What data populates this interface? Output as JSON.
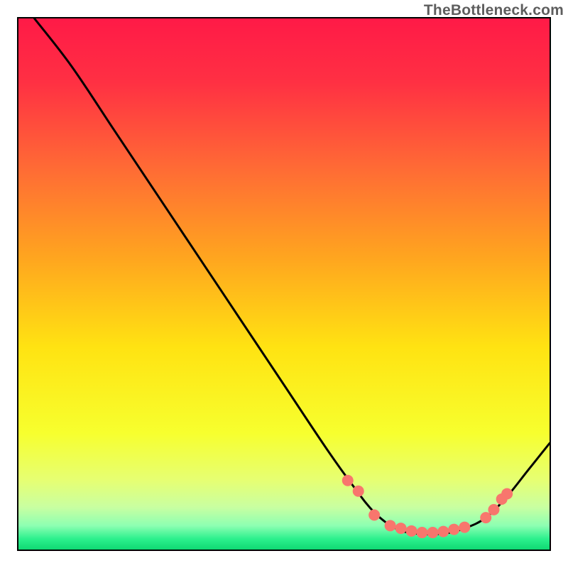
{
  "watermark": "TheBottleneck.com",
  "chart_data": {
    "type": "line",
    "title": "",
    "xlabel": "",
    "ylabel": "",
    "xlim": [
      0,
      100
    ],
    "ylim": [
      0,
      100
    ],
    "curve": [
      {
        "x": 3,
        "y": 100
      },
      {
        "x": 10,
        "y": 91
      },
      {
        "x": 18,
        "y": 79
      },
      {
        "x": 26,
        "y": 67
      },
      {
        "x": 34,
        "y": 55
      },
      {
        "x": 42,
        "y": 43
      },
      {
        "x": 50,
        "y": 31
      },
      {
        "x": 58,
        "y": 19
      },
      {
        "x": 63,
        "y": 12
      },
      {
        "x": 67,
        "y": 7
      },
      {
        "x": 71,
        "y": 4
      },
      {
        "x": 75,
        "y": 3
      },
      {
        "x": 80,
        "y": 3
      },
      {
        "x": 84,
        "y": 4
      },
      {
        "x": 88,
        "y": 6
      },
      {
        "x": 92,
        "y": 10
      },
      {
        "x": 96,
        "y": 15
      },
      {
        "x": 100,
        "y": 20
      }
    ],
    "markers": [
      {
        "x": 62,
        "y": 13
      },
      {
        "x": 64,
        "y": 11
      },
      {
        "x": 67,
        "y": 6.5
      },
      {
        "x": 70,
        "y": 4.5
      },
      {
        "x": 72,
        "y": 4
      },
      {
        "x": 74,
        "y": 3.5
      },
      {
        "x": 76,
        "y": 3.2
      },
      {
        "x": 78,
        "y": 3.2
      },
      {
        "x": 80,
        "y": 3.4
      },
      {
        "x": 82,
        "y": 3.8
      },
      {
        "x": 84,
        "y": 4.2
      },
      {
        "x": 88,
        "y": 6
      },
      {
        "x": 89.5,
        "y": 7.5
      },
      {
        "x": 91,
        "y": 9.5
      },
      {
        "x": 92,
        "y": 10.5
      }
    ],
    "gradient_stops": [
      {
        "offset": 0,
        "color": "#ff1a47"
      },
      {
        "offset": 0.12,
        "color": "#ff3043"
      },
      {
        "offset": 0.28,
        "color": "#ff6a35"
      },
      {
        "offset": 0.45,
        "color": "#ffa51f"
      },
      {
        "offset": 0.62,
        "color": "#ffe312"
      },
      {
        "offset": 0.78,
        "color": "#f7ff2e"
      },
      {
        "offset": 0.87,
        "color": "#e6ff73"
      },
      {
        "offset": 0.92,
        "color": "#c9ffa1"
      },
      {
        "offset": 0.955,
        "color": "#8dffb2"
      },
      {
        "offset": 0.98,
        "color": "#2cf08d"
      },
      {
        "offset": 1.0,
        "color": "#0fd873"
      }
    ],
    "marker_color": "#f8766d",
    "marker_radius_px": 8
  }
}
